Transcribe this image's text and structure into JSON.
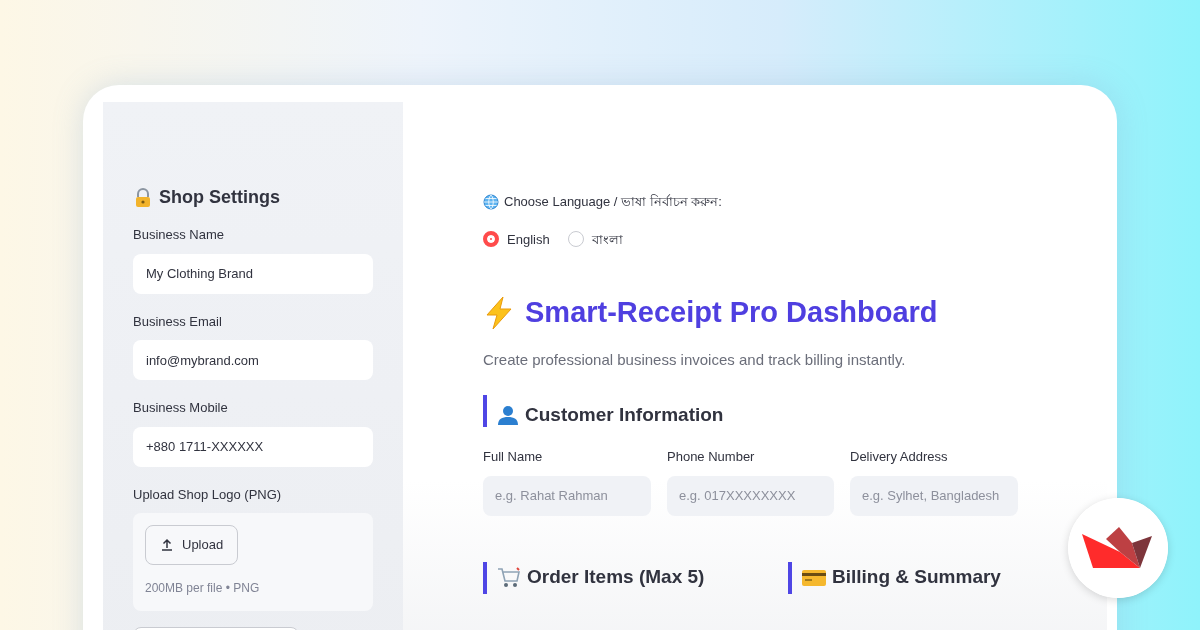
{
  "sidebar": {
    "title": "Shop Settings",
    "fields": [
      {
        "label": "Business Name",
        "value": "My Clothing Brand"
      },
      {
        "label": "Business Email",
        "value": "info@mybrand.com"
      },
      {
        "label": "Business Mobile",
        "value": "+880 1711-XXXXXX"
      }
    ],
    "upload": {
      "label": "Upload Shop Logo (PNG)",
      "button": "Upload",
      "hint": "200MB per file • PNG"
    }
  },
  "language": {
    "label": "Choose Language / ভাষা নির্বাচন করুন:",
    "options": [
      {
        "label": "English",
        "selected": true
      },
      {
        "label": "বাংলা",
        "selected": false
      }
    ]
  },
  "header": {
    "title": "Smart-Receipt Pro Dashboard",
    "subtitle": "Create professional business invoices and track billing instantly."
  },
  "customer": {
    "title": "Customer Information",
    "fields": [
      {
        "label": "Full Name",
        "placeholder": "e.g. Rahat Rahman"
      },
      {
        "label": "Phone Number",
        "placeholder": "e.g. 017XXXXXXXX"
      },
      {
        "label": "Delivery Address",
        "placeholder": "e.g. Sylhet, Bangladesh"
      }
    ]
  },
  "sections": [
    {
      "title": "Order Items (Max 5)",
      "kind": "cart"
    },
    {
      "title": "Billing & Summary",
      "kind": "card"
    }
  ]
}
